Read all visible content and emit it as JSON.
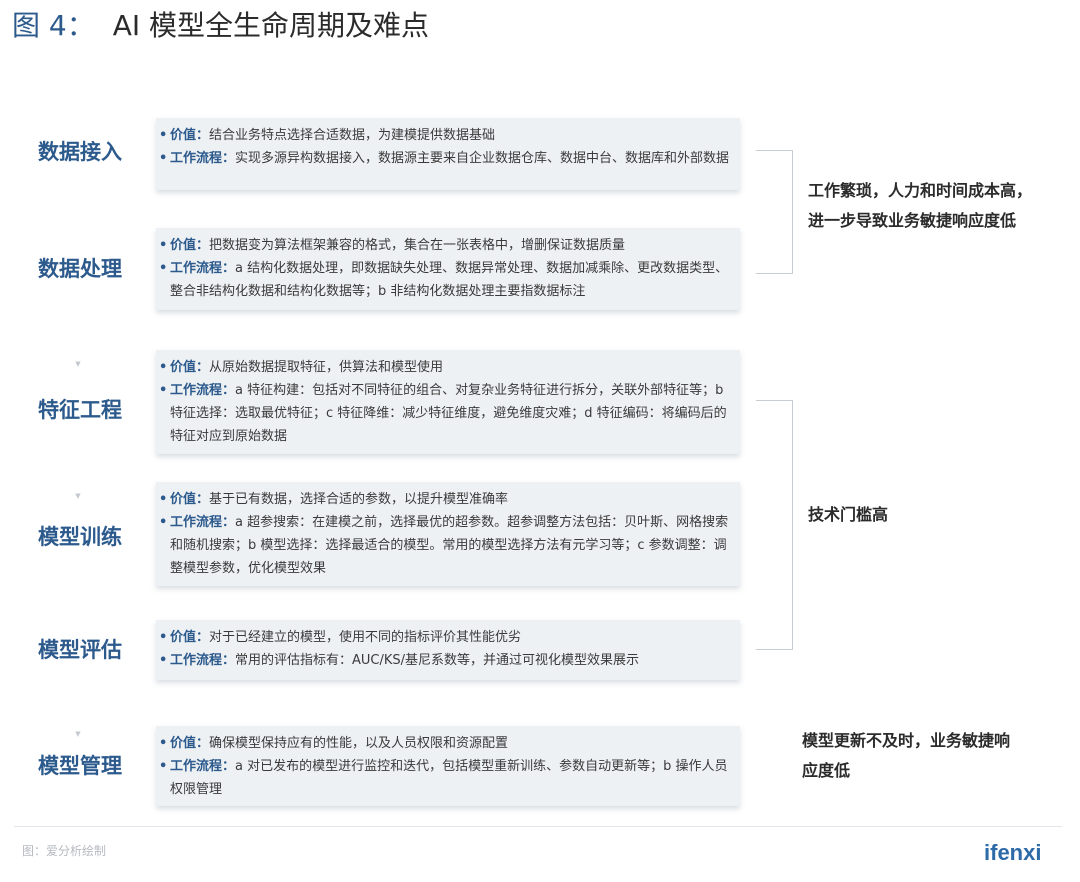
{
  "title": {
    "number": "图 4：",
    "text": "AI 模型全生命周期及难点"
  },
  "stages": [
    {
      "name": "数据接入",
      "lines": [
        {
          "label": "价值：",
          "text": "结合业务特点选择合适数据，为建模提供数据基础"
        },
        {
          "label": "工作流程：",
          "text": "实现多源异构数据接入，数据源主要来自企业数据仓库、数据中台、数据库和外部数据"
        }
      ]
    },
    {
      "name": "数据处理",
      "lines": [
        {
          "label": "价值：",
          "text": "把数据变为算法框架兼容的格式，集合在一张表格中，增删保证数据质量"
        },
        {
          "label": "工作流程：",
          "text": "a 结构化数据处理，即数据缺失处理、数据异常处理、数据加减乘除、更改数据类型、整合非结构化数据和结构化数据等；b 非结构化数据处理主要指数据标注"
        }
      ]
    },
    {
      "name": "特征工程",
      "lines": [
        {
          "label": "价值：",
          "text": "从原始数据提取特征，供算法和模型使用"
        },
        {
          "label": "工作流程：",
          "text": "a 特征构建：包括对不同特征的组合、对复杂业务特征进行拆分，关联外部特征等；b 特征选择：选取最优特征；c 特征降维：减少特征维度，避免维度灾难；d 特征编码：将编码后的特征对应到原始数据"
        }
      ]
    },
    {
      "name": "模型训练",
      "lines": [
        {
          "label": "价值：",
          "text": "基于已有数据，选择合适的参数，以提升模型准确率"
        },
        {
          "label": "工作流程：",
          "text": "a 超参搜索：在建模之前，选择最优的超参数。超参调整方法包括：贝叶斯、网格搜索和随机搜索；b 模型选择：选择最适合的模型。常用的模型选择方法有元学习等；c 参数调整：调整模型参数，优化模型效果"
        }
      ]
    },
    {
      "name": "模型评估",
      "lines": [
        {
          "label": "价值：",
          "text": "对于已经建立的模型，使用不同的指标评价其性能优劣"
        },
        {
          "label": "工作流程：",
          "text": "常用的评估指标有：AUC/KS/基尼系数等，并通过可视化模型效果展示"
        }
      ]
    },
    {
      "name": "模型管理",
      "lines": [
        {
          "label": "价值：",
          "text": "确保模型保持应有的性能，以及人员权限和资源配置"
        },
        {
          "label": "工作流程：",
          "text": "a 对已发布的模型进行监控和迭代，包括模型重新训练、参数自动更新等；b 操作人员权限管理"
        }
      ]
    }
  ],
  "notes": [
    {
      "lines": [
        "工作繁琐，人力和时间成本高，",
        "进一步导致业务敏捷响应度低"
      ]
    },
    {
      "lines": [
        "技术门槛高"
      ]
    },
    {
      "lines": [
        "模型更新不及时，业务敏捷响",
        "应度低"
      ]
    }
  ],
  "source": "图：爱分析绘制",
  "brand": "ifenxi",
  "arrow_glyph": "▼",
  "bullet_glyph": "•"
}
